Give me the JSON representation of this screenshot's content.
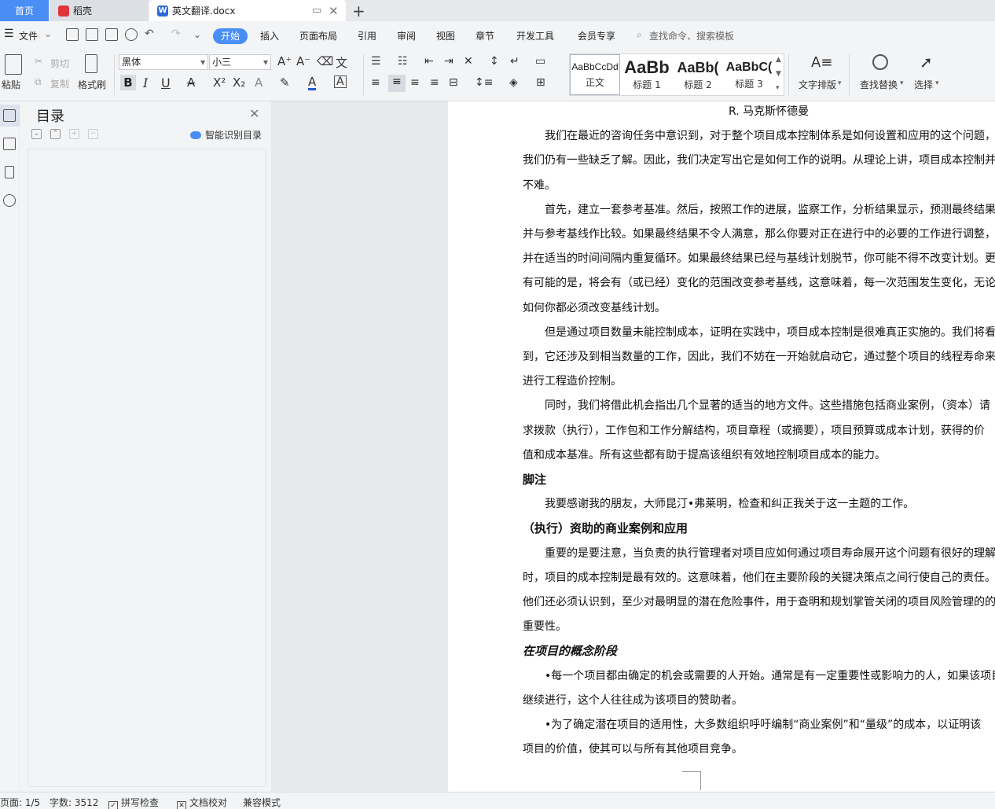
{
  "tabs": {
    "home": "首页",
    "daoke": "稻壳",
    "doc": "英文翻译.docx"
  },
  "menu": {
    "file": "文件",
    "items": [
      "开始",
      "插入",
      "页面布局",
      "引用",
      "审阅",
      "视图",
      "章节",
      "开发工具",
      "会员专享"
    ],
    "search": "查找命令、搜索模板"
  },
  "ribbon": {
    "paste": "粘贴",
    "cut": "剪切",
    "copy": "复制",
    "format_painter": "格式刷",
    "font_name": "黑体",
    "font_size": "小三",
    "styles": [
      {
        "preview": "AaBbCcDd",
        "label": "正文"
      },
      {
        "preview": "AaBb",
        "label": "标题 1"
      },
      {
        "preview": "AaBb(",
        "label": "标题 2"
      },
      {
        "preview": "AaBbC(",
        "label": "标题 3"
      }
    ],
    "text_layout": "文字排版",
    "find_replace": "查找替换",
    "select": "选择"
  },
  "toc": {
    "title": "目录",
    "smart_detect": "智能识别目录"
  },
  "document": {
    "lines": [
      {
        "cls": "h-center",
        "text": "R. 马克斯怀德曼"
      },
      {
        "cls": "indent",
        "text": "我们在最近的咨询任务中意识到，对于整个项目成本控制体系是如何设置和应用的这个问题，"
      },
      {
        "cls": "",
        "text": "我们仍有一些缺乏了解。因此，我们决定写出它是如何工作的说明。从理论上讲，项目成本控制并"
      },
      {
        "cls": "",
        "text": "不难。"
      },
      {
        "cls": "indent",
        "text": "首先，建立一套参考基准。然后，按照工作的进展，监察工作，分析结果显示，预测最终结果"
      },
      {
        "cls": "",
        "text": "并与参考基线作比较。如果最终结果不令人满意，那么你要对正在进行中的必要的工作进行调整，"
      },
      {
        "cls": "",
        "text": "并在适当的时间间隔内重复循环。如果最终结果已经与基线计划脱节，你可能不得不改变计划。更"
      },
      {
        "cls": "",
        "text": "有可能的是，将会有（或已经）变化的范围改变参考基线，这意味着，每一次范围发生变化，无论"
      },
      {
        "cls": "",
        "text": "如何你都必须改变基线计划。"
      },
      {
        "cls": "indent",
        "text": "但是通过项目数量未能控制成本，证明在实践中，项目成本控制是很难真正实施的。我们将看"
      },
      {
        "cls": "",
        "text": "到，它还涉及到相当数量的工作，因此，我们不妨在一开始就启动它，通过整个项目的线程寿命来"
      },
      {
        "cls": "",
        "text": "进行工程造价控制。"
      },
      {
        "cls": "indent",
        "text": "同时，我们将借此机会指出几个显著的适当的地方文件。这些措施包括商业案例，（资本）请"
      },
      {
        "cls": "",
        "text": "求拨款（执行），工作包和工作分解结构，项目章程（或摘要），项目预算或成本计划，获得的价"
      },
      {
        "cls": "",
        "text": "值和成本基准。所有这些都有助于提高该组织有效地控制项目成本的能力。"
      },
      {
        "cls": "h-bold",
        "text": "脚注"
      },
      {
        "cls": "indent",
        "text": "我要感谢我的朋友，大师昆汀•弗莱明，检查和纠正我关于这一主题的工作。"
      },
      {
        "cls": "h-bold",
        "text": "（执行）资助的商业案例和应用"
      },
      {
        "cls": "indent",
        "text": "重要的是要注意，当负责的执行管理者对项目应如何通过项目寿命展开这个问题有很好的理解"
      },
      {
        "cls": "",
        "text": "时，项目的成本控制是最有效的。这意味着，他们在主要阶段的关键决策点之间行使自己的责任。"
      },
      {
        "cls": "",
        "text": "他们还必须认识到，至少对最明显的潜在危险事件，用于查明和规划掌管关闭的项目风险管理的的"
      },
      {
        "cls": "",
        "text": "重要性。"
      },
      {
        "cls": "h-bold-italic",
        "text": "在项目的概念阶段"
      },
      {
        "cls": "indent",
        "text": "•每一个项目都由确定的机会或需要的人开始。通常是有一定重要性或影响力的人，如果该项目"
      },
      {
        "cls": "",
        "text": "继续进行，这个人往往成为该项目的赞助者。"
      },
      {
        "cls": "indent",
        "text": "•为了确定潜在项目的适用性，大多数组织呼吁编制“商业案例”和“量级”的成本，以证明该"
      },
      {
        "cls": "",
        "text": "项目的价值，使其可以与所有其他项目竞争。"
      }
    ]
  },
  "status": {
    "page": "页面: 1/5",
    "words": "字数: 3512",
    "spell": "拼写检查",
    "proof": "文档校对",
    "compat": "兼容模式"
  }
}
